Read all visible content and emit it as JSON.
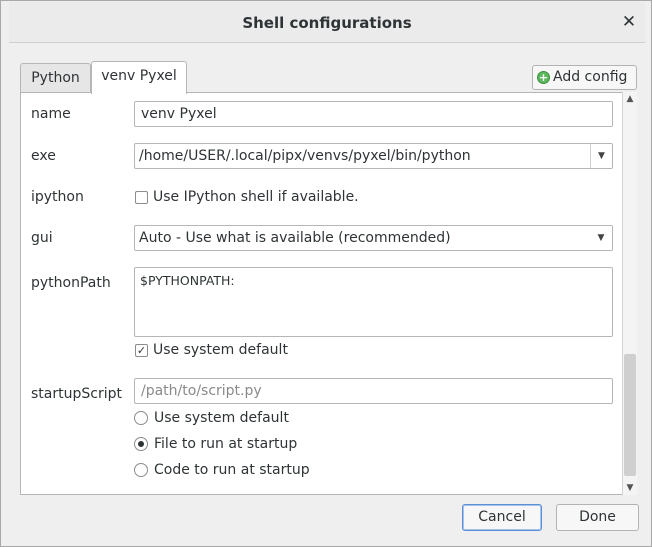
{
  "window": {
    "title": "Shell configurations",
    "close_glyph": "✕"
  },
  "tabs": [
    {
      "label": "Python",
      "active": false
    },
    {
      "label": "venv Pyxel",
      "active": true
    }
  ],
  "toolbar": {
    "add_config_label": "Add config",
    "add_config_icon": "plus-circle-icon"
  },
  "form": {
    "name": {
      "label": "name",
      "value": "venv Pyxel"
    },
    "exe": {
      "label": "exe",
      "value": "/home/USER/.local/pipx/venvs/pyxel/bin/python"
    },
    "ipython": {
      "label": "ipython",
      "checkbox_label": "Use IPython shell if available.",
      "checked": false
    },
    "gui": {
      "label": "gui",
      "value": "Auto  -  Use what is available (recommended)"
    },
    "pythonPath": {
      "label": "pythonPath",
      "value": "$PYTHONPATH:",
      "use_default_label": "Use system default",
      "use_default_checked": true
    },
    "startupScript": {
      "label": "startupScript",
      "placeholder": "/path/to/script.py",
      "options": [
        {
          "label": "Use system default",
          "selected": false
        },
        {
          "label": "File to run at startup",
          "selected": true
        },
        {
          "label": "Code to run at startup",
          "selected": false
        }
      ]
    }
  },
  "buttons": {
    "cancel": "Cancel",
    "done": "Done"
  },
  "colors": {
    "accent": "#5b8fd6",
    "add_icon": "#5cb85c"
  }
}
